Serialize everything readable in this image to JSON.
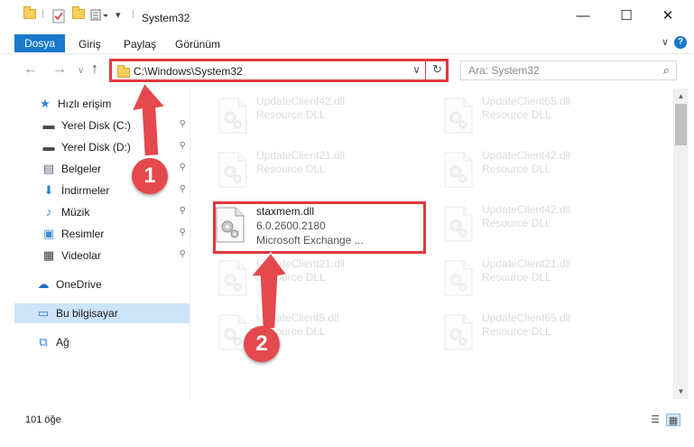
{
  "window": {
    "title": "System32",
    "minimize_glyph": "—",
    "maximize_glyph": "☐",
    "close_glyph": "✕"
  },
  "ribbon": {
    "file_tab": "Dosya",
    "tabs": [
      "Giriş",
      "Paylaş",
      "Görünüm"
    ],
    "help_glyph": "?",
    "collapse_glyph": "∨"
  },
  "nav": {
    "back_glyph": "←",
    "forward_glyph": "→",
    "recent_glyph": "∨",
    "up_glyph": "↑",
    "address": "C:\\Windows\\System32",
    "address_drop_glyph": "∨",
    "refresh_glyph": "↻",
    "search_placeholder": "Ara: System32",
    "search_glyph": "⌕"
  },
  "sidebar": {
    "items": [
      {
        "label": "Hızlı erişim",
        "icon": "star-icon",
        "glyph": "★",
        "color": "#2f7fd6",
        "pinned": false
      },
      {
        "label": "Yerel Disk (C:)",
        "icon": "drive-icon",
        "glyph": "▬",
        "color": "#4a4a4a",
        "pinned": true
      },
      {
        "label": "Yerel Disk (D:)",
        "icon": "drive-icon",
        "glyph": "▬",
        "color": "#4a4a4a",
        "pinned": true
      },
      {
        "label": "Belgeler",
        "icon": "documents-icon",
        "glyph": "▤",
        "color": "#5a6b85",
        "pinned": true
      },
      {
        "label": "İndirmeler",
        "icon": "download-icon",
        "glyph": "⬇",
        "color": "#2f7fd6",
        "pinned": true
      },
      {
        "label": "Müzik",
        "icon": "music-icon",
        "glyph": "♪",
        "color": "#2f7fd6",
        "pinned": true
      },
      {
        "label": "Resimler",
        "icon": "pictures-icon",
        "glyph": "▣",
        "color": "#3d8bd4",
        "pinned": true
      },
      {
        "label": "Videolar",
        "icon": "video-icon",
        "glyph": "▦",
        "color": "#3b3b3b",
        "pinned": true
      },
      {
        "label": "OneDrive",
        "icon": "cloud-icon",
        "glyph": "☁",
        "color": "#1e6fc1",
        "pinned": false
      },
      {
        "label": "Bu bilgisayar",
        "icon": "computer-icon",
        "glyph": "▭",
        "color": "#2f7fd6",
        "pinned": false
      },
      {
        "label": "Ağ",
        "icon": "network-icon",
        "glyph": "⧉",
        "color": "#2f7fd6",
        "pinned": false
      }
    ],
    "pin_glyph": "📌"
  },
  "files": {
    "left": [
      {
        "name": "UpdateClient42.dll",
        "sub": "Resource DLL"
      },
      {
        "name": "UpdateClient21.dll",
        "sub": "Resource DLL"
      },
      {
        "name": "UpdateClient21.dll",
        "sub": "Resource DLL"
      },
      {
        "name": "UpdateClient5.dll",
        "sub": "Resource DLL"
      }
    ],
    "right": [
      {
        "name": "UpdateClient65.dll",
        "sub": "Resource DLL"
      },
      {
        "name": "UpdateClient42.dll",
        "sub": "Resource DLL"
      },
      {
        "name": "UpdateClient42.dll",
        "sub": "Resource DLL"
      },
      {
        "name": "UpdateClient21.dll",
        "sub": "Resource DLL"
      },
      {
        "name": "UpdateClient65.dll",
        "sub": "Resource DLL"
      }
    ],
    "highlighted": {
      "name": "staxmem.dll",
      "version": "6.0.2600.2180",
      "company": "Microsoft Exchange ..."
    }
  },
  "status": {
    "count": "101 öğe"
  },
  "annotations": {
    "step1": "1",
    "step2": "2",
    "color": "#e5484d"
  }
}
